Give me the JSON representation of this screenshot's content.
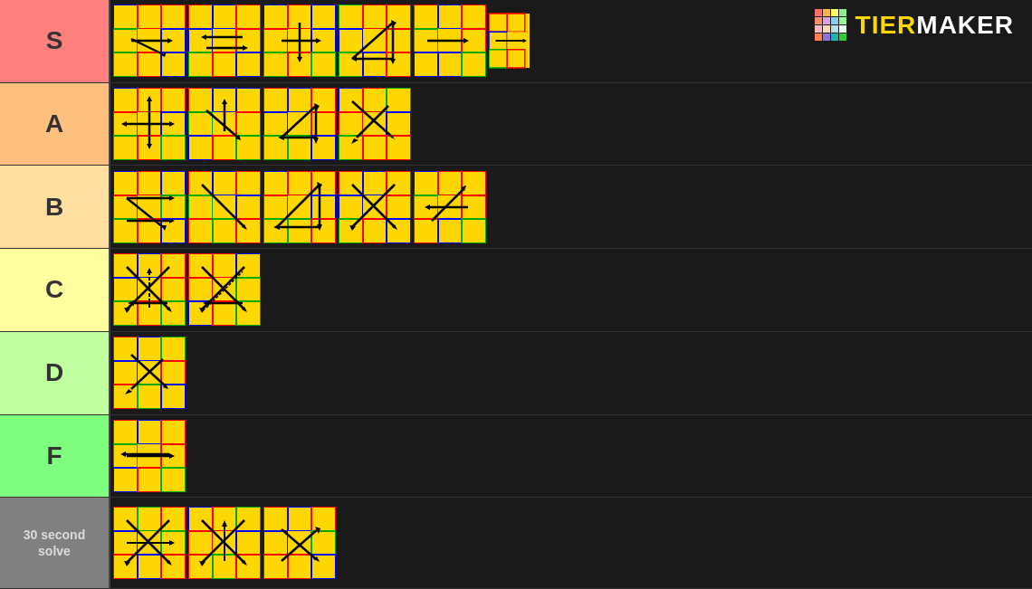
{
  "tiers": [
    {
      "id": "s",
      "label": "S",
      "color": "#FF7F7F",
      "textColor": "#333",
      "cubeCount": 6
    },
    {
      "id": "a",
      "label": "A",
      "color": "#FFBF7F",
      "textColor": "#333",
      "cubeCount": 4
    },
    {
      "id": "b",
      "label": "B",
      "color": "#FFDF9F",
      "textColor": "#333",
      "cubeCount": 5
    },
    {
      "id": "c",
      "label": "C",
      "color": "#FFFF9F",
      "textColor": "#333",
      "cubeCount": 2
    },
    {
      "id": "d",
      "label": "D",
      "color": "#BFFF9F",
      "textColor": "#333",
      "cubeCount": 1
    },
    {
      "id": "f",
      "label": "F",
      "color": "#7FFF7F",
      "textColor": "#333",
      "cubeCount": 1
    },
    {
      "id": "special",
      "label": "30 second\nsolve",
      "color": "#808080",
      "textColor": "#ddd",
      "cubeCount": 3
    }
  ],
  "logo": {
    "text": "TiERMAKER",
    "tier_part": "TiER",
    "maker_part": "MAKER"
  }
}
